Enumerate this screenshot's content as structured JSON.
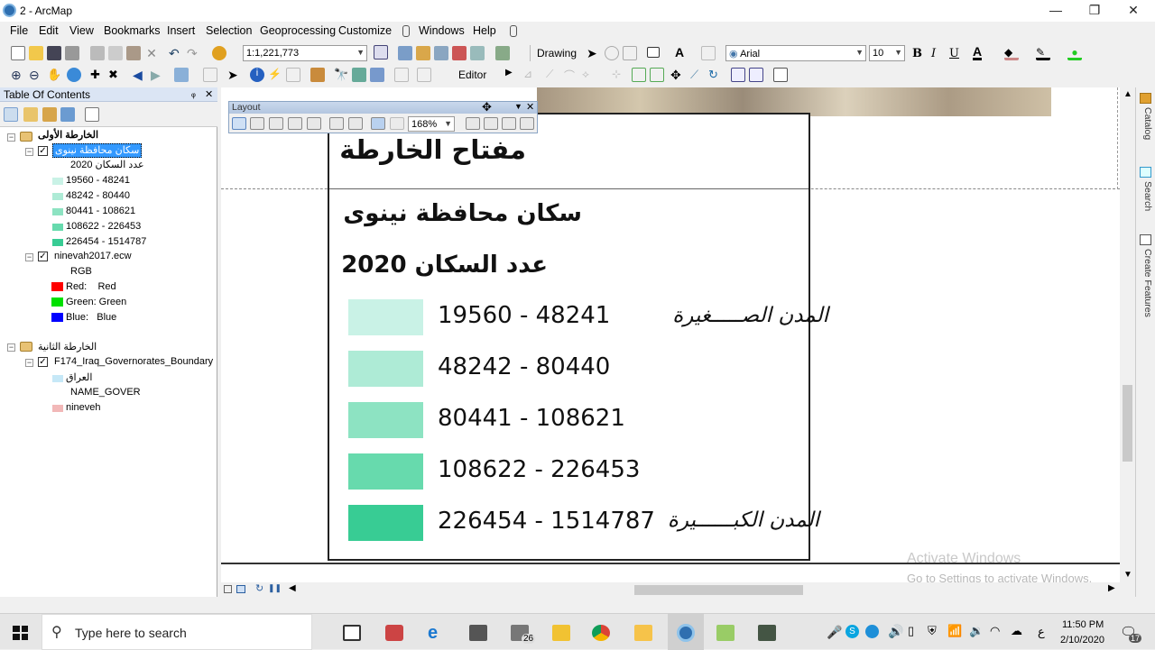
{
  "app": {
    "title": "2 - ArcMap",
    "window_controls": [
      "—",
      "❐",
      "✕"
    ]
  },
  "menu": [
    "File",
    "Edit",
    "View",
    "Bookmarks",
    "Insert",
    "Selection",
    "Geoprocessing",
    "Customize",
    "Windows",
    "Help"
  ],
  "toolbar": {
    "scale": "1:1,221,773",
    "drawing_label": "Drawing",
    "font": "Arial",
    "font_size": "10",
    "bold": "B",
    "italic": "I",
    "underline": "U",
    "text_tool": "A",
    "editor_label": "Editor"
  },
  "toc": {
    "title": "Table Of Contents",
    "pin": "ᵩ",
    "close": "✕",
    "frame1": {
      "name": "الخارطة الأولى",
      "layer1": {
        "name": "سكان محافظة نينوى",
        "field": "عدد السكان 2020",
        "classes": [
          {
            "label": "19560 - 48241",
            "color": "#c9f2e6"
          },
          {
            "label": "48242 - 80440",
            "color": "#aeebd6"
          },
          {
            "label": "80441 - 108621",
            "color": "#8de3c2"
          },
          {
            "label": "108622 - 226453",
            "color": "#67daad"
          },
          {
            "label": "226454 - 1514787",
            "color": "#38cc94"
          }
        ]
      },
      "layer2": {
        "name": "ninevah2017.ecw",
        "mode": "RGB",
        "bands": [
          {
            "label": "Red:    Red",
            "color": "#ff0000"
          },
          {
            "label": "Green: Green",
            "color": "#00e000"
          },
          {
            "label": "Blue:   Blue",
            "color": "#0000ff"
          }
        ]
      }
    },
    "frame2": {
      "name": "الخارطة الثانية",
      "layer1": {
        "name": "F174_Iraq_Governorates_Boundary",
        "items": [
          {
            "label": "العراق",
            "color": "#c6e8f7"
          },
          {
            "label": "NAME_GOVER",
            "color": ""
          },
          {
            "label": "nineveh",
            "color": "#f2b8b8"
          }
        ]
      }
    }
  },
  "layout_toolbar": {
    "title": "Layout",
    "zoom": "168%"
  },
  "legend": {
    "heading": "مفتاح الخارطة",
    "title": "سكان محافظة نينوى",
    "subtitle": "عدد السكان 2020",
    "small_cities": "المدن الصـــــغيرة",
    "large_cities": "المدن الكبــــــيرة"
  },
  "right_tabs": [
    "Catalog",
    "Search",
    "Create Features"
  ],
  "watermark": {
    "line1": "Activate Windows",
    "line2": "Go to Settings to activate Windows."
  },
  "taskbar": {
    "search_placeholder": "Type here to search",
    "time": "11:50 PM",
    "date": "2/10/2020",
    "lang": "ع",
    "notif_count": "17",
    "mail_count": "26"
  }
}
